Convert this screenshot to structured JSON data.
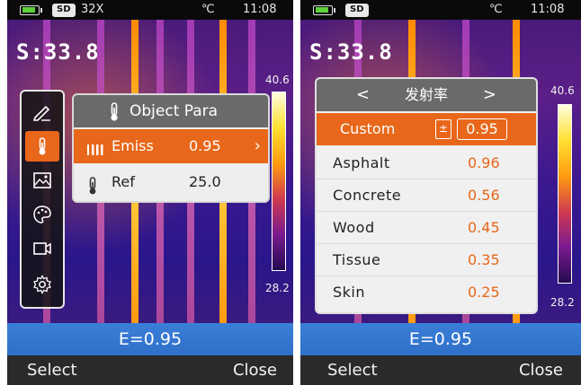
{
  "left_screen": {
    "status": {
      "sd": "SD",
      "zoom": "32X",
      "unit": "℃",
      "time": "11:08"
    },
    "spot": "S:33.8",
    "scale": {
      "max": "40.6",
      "min": "28.2"
    },
    "side_menu": [
      {
        "name": "edit-icon"
      },
      {
        "name": "thermometer-icon",
        "active": true
      },
      {
        "name": "image-icon"
      },
      {
        "name": "palette-icon"
      },
      {
        "name": "video-icon"
      },
      {
        "name": "settings-icon"
      }
    ],
    "panel": {
      "title": "Object Para",
      "emiss_label": "Emiss",
      "emiss_value": "0.95",
      "ref_label": "Ref",
      "ref_value": "25.0"
    },
    "emissivity_display": "E=0.95",
    "softkeys": {
      "left": "Select",
      "right": "Close"
    }
  },
  "right_screen": {
    "status": {
      "sd": "SD",
      "unit": "℃",
      "time": "11:08"
    },
    "spot": "S:33.8",
    "scale": {
      "max": "40.6",
      "min": "28.2"
    },
    "picker": {
      "header": "发射率",
      "nav_prev": "<",
      "nav_next": ">",
      "custom_label": "Custom",
      "custom_adjust": "±",
      "custom_value": "0.95",
      "materials": [
        {
          "label": "Asphalt",
          "value": "0.96"
        },
        {
          "label": "Concrete",
          "value": "0.56"
        },
        {
          "label": "Wood",
          "value": "0.45"
        },
        {
          "label": "Tissue",
          "value": "0.35"
        },
        {
          "label": "Skin",
          "value": "0.25"
        }
      ]
    },
    "emissivity_display": "E=0.95",
    "softkeys": {
      "left": "Select",
      "right": "Close"
    }
  },
  "colors": {
    "accent": "#e8671a",
    "footer": "#3a7fd8",
    "battery": "#5fd03a"
  }
}
